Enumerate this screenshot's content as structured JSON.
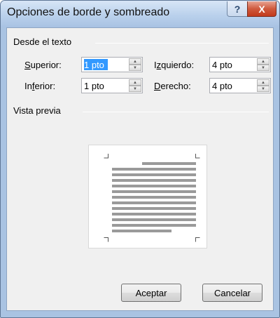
{
  "window": {
    "title": "Opciones de borde y sombreado",
    "help_symbol": "?",
    "close_symbol": "X"
  },
  "from_text": {
    "title": "Desde el texto",
    "superior": {
      "label_key": "S",
      "label_rest": "uperior:",
      "value": "1 pto"
    },
    "inferior": {
      "label_pre": "In",
      "label_key": "f",
      "label_rest": "erior:",
      "value": "1 pto"
    },
    "izquierdo": {
      "label_pre": "I",
      "label_key": "z",
      "label_rest": "quierdo:",
      "value": "4 pto"
    },
    "derecho": {
      "label_key": "D",
      "label_rest": "erecho:",
      "value": "4 pto"
    }
  },
  "preview": {
    "title": "Vista previa"
  },
  "buttons": {
    "ok": "Aceptar",
    "cancel": "Cancelar"
  },
  "colors": {
    "selection": "#3399ff",
    "preview_lines": "#9a9a9a",
    "close_button": "#c23a1c"
  }
}
